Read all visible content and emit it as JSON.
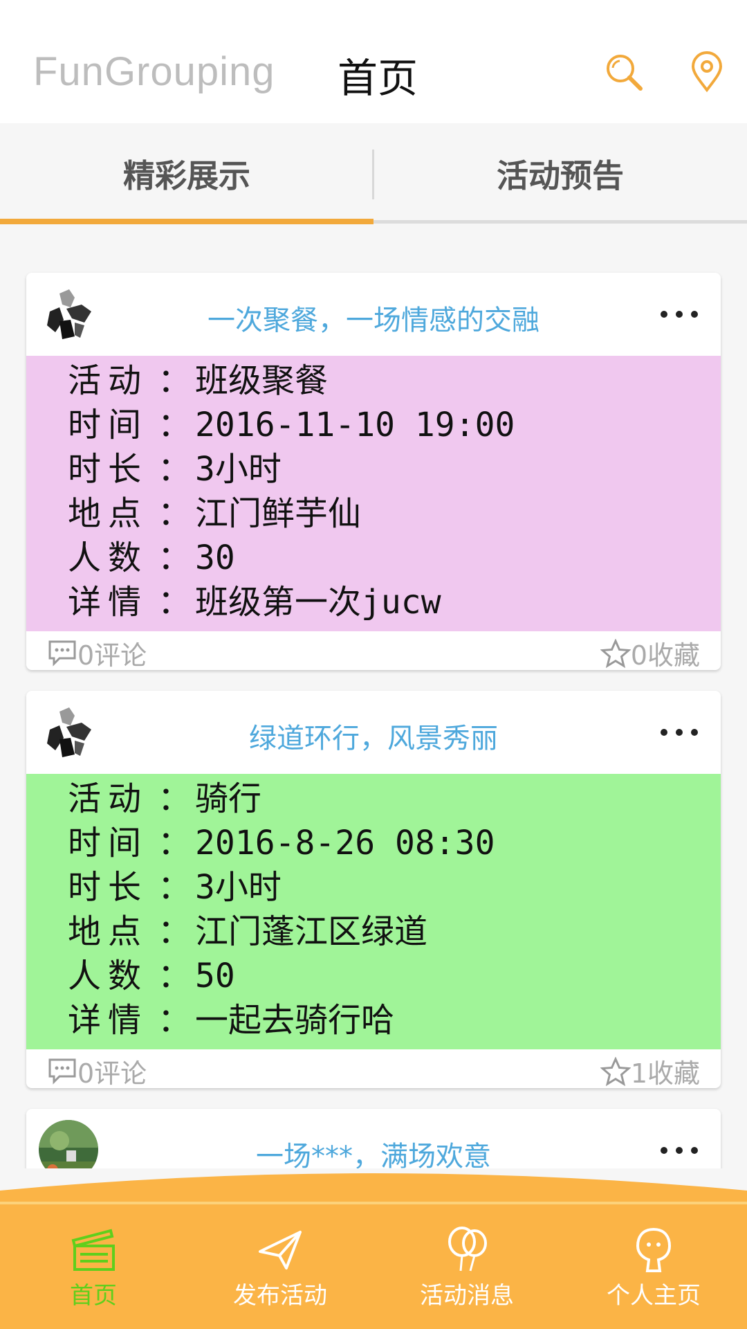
{
  "header": {
    "app_title": "FunGrouping",
    "page_title": "首页",
    "search_icon": "search-icon",
    "location_icon": "location-pin-icon"
  },
  "tabs": [
    {
      "label": "精彩展示",
      "active": true
    },
    {
      "label": "活动预告",
      "active": false
    }
  ],
  "cards": [
    {
      "title": "一次聚餐，一场情感的交融",
      "bg": "#f0c8ef",
      "rows": [
        {
          "k": "活动",
          "sep": "：",
          "v": "班级聚餐"
        },
        {
          "k": "时间",
          "sep": "：",
          "v": "2016-11-10 19:00"
        },
        {
          "k": "时长",
          "sep": "：",
          "v": "3小时"
        },
        {
          "k": "地点",
          "sep": "：",
          "v": "江门鲜芋仙"
        },
        {
          "k": "人数",
          "sep": "：",
          "v": "30"
        },
        {
          "k": "详情",
          "sep": "：",
          "v": "班级第一次jucw"
        }
      ],
      "comments": "0评论",
      "favorites": "0收藏"
    },
    {
      "title": "绿道环行，风景秀丽",
      "bg": "#a0f498",
      "rows": [
        {
          "k": "活动",
          "sep": "：",
          "v": "骑行"
        },
        {
          "k": "时间",
          "sep": "：",
          "v": "2016-8-26 08:30"
        },
        {
          "k": "时长",
          "sep": "：",
          "v": "3小时"
        },
        {
          "k": "地点",
          "sep": "：",
          "v": "江门蓬江区绿道"
        },
        {
          "k": "人数",
          "sep": "：",
          "v": "50"
        },
        {
          "k": "详情",
          "sep": "：",
          "v": "一起去骑行哈"
        }
      ],
      "comments": "0评论",
      "favorites": "1收藏"
    },
    {
      "title": "一场***，满场欢意"
    }
  ],
  "bottom_nav": [
    {
      "label": "首页",
      "icon": "clapperboard-icon",
      "active": true
    },
    {
      "label": "发布活动",
      "icon": "paper-plane-icon",
      "active": false
    },
    {
      "label": "活动消息",
      "icon": "balloons-icon",
      "active": false
    },
    {
      "label": "个人主页",
      "icon": "person-icon",
      "active": false
    }
  ],
  "colors": {
    "accent": "#f2a93b",
    "bottom_bar": "#fbb446",
    "title_blue": "#4ea8dc",
    "active_nav": "#5fcf1c"
  }
}
